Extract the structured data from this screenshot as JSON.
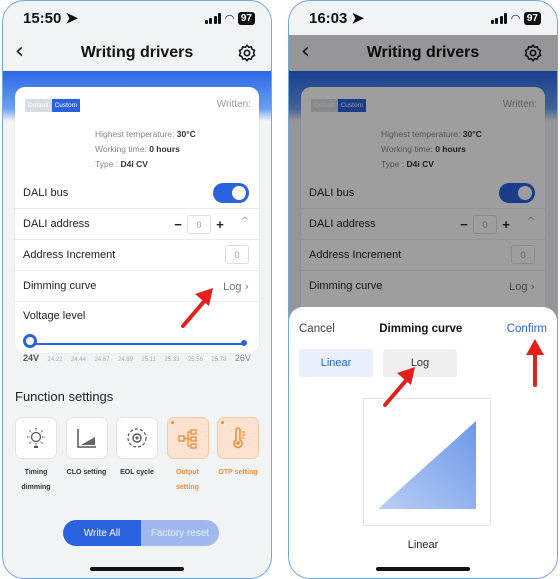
{
  "left": {
    "status": {
      "time": "15:50",
      "battery": "97"
    },
    "nav": {
      "title": "Writing drivers"
    },
    "card": {
      "mode_options": [
        "Default",
        "Custom"
      ],
      "written_label": "Written:",
      "info": {
        "temp_label": "Highest temperature:",
        "temp_value": "30°C",
        "work_label": "Working time:",
        "work_value": "0 hours",
        "type_label": "Type :",
        "type_value": "D4i CV"
      },
      "dali_bus_label": "DALI bus",
      "dali_address_label": "DALI address",
      "dali_address_value": "0",
      "address_increment_label": "Address Increment",
      "address_increment_value": "0",
      "dimming_curve_label": "Dimming curve",
      "dimming_curve_value": "Log",
      "voltage_label": "Voltage level",
      "voltage_ticks": [
        "24V",
        "24.22",
        "24.44",
        "24.67",
        "24.89",
        "25.11",
        "25.33",
        "25.56",
        "25.78",
        "26V"
      ]
    },
    "function_title": "Function settings",
    "functions": [
      {
        "label": "Timing dimming",
        "icon": "sun-timer-icon",
        "highlight": false
      },
      {
        "label": "CLO setting",
        "icon": "clo-chart-icon",
        "highlight": false
      },
      {
        "label": "EOL cycle",
        "icon": "cycle-gear-icon",
        "highlight": false
      },
      {
        "label": "Output setting",
        "icon": "output-nodes-icon",
        "highlight": true
      },
      {
        "label": "OTP setting",
        "icon": "thermometer-icon",
        "highlight": true
      }
    ],
    "buttons": {
      "write_all": "Write All",
      "factory_reset": "Factory reset"
    }
  },
  "right": {
    "status": {
      "time": "16:03",
      "battery": "97"
    },
    "nav": {
      "title": "Writing drivers"
    },
    "background": {
      "mode_options": [
        "Default",
        "Custom"
      ],
      "written_label": "Written:",
      "info": {
        "temp_label": "Highest temperature:",
        "temp_value": "30°C",
        "work_label": "Working time:",
        "work_value": "0 hours",
        "type_label": "Type :",
        "type_value": "D4i CV"
      },
      "dali_bus_label": "DALI bus",
      "dali_address_label": "DALI address",
      "dali_address_value": "0",
      "address_increment_label": "Address Increment",
      "address_increment_value": "0",
      "dimming_curve_label": "Dimming curve",
      "dimming_curve_value": "Log"
    },
    "sheet": {
      "cancel": "Cancel",
      "title": "Dimming curve",
      "confirm": "Confirm",
      "options": [
        "Linear",
        "Log"
      ],
      "selected": "Linear",
      "preview_label": "Linear"
    }
  },
  "colors": {
    "accent": "#2a62e0",
    "orange": "#f08c3a",
    "annotation_arrow": "#e3211c"
  },
  "voltage_level": 1.0
}
